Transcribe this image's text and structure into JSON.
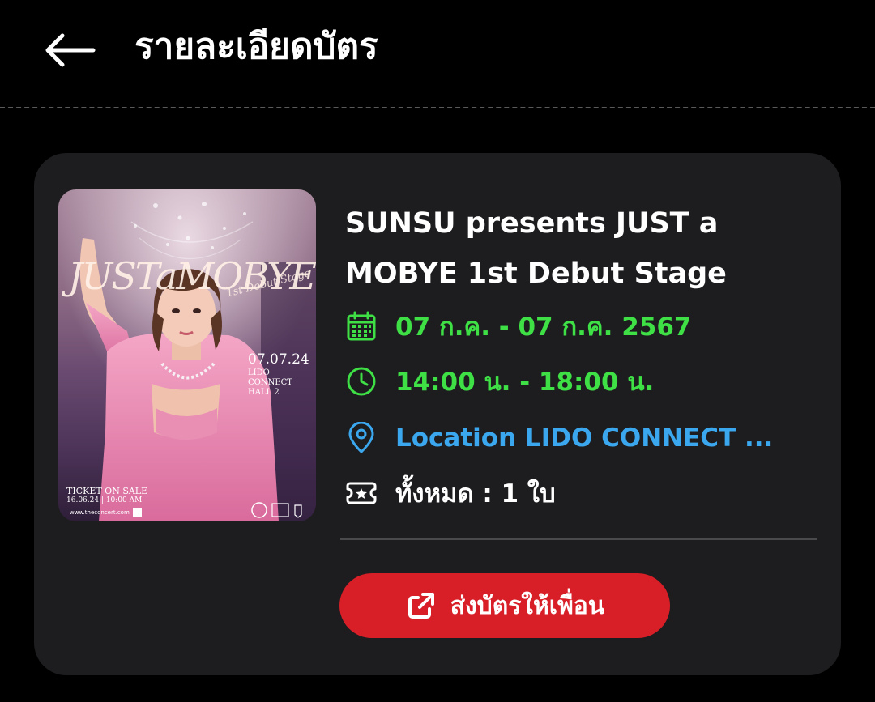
{
  "header": {
    "title": "รายละเอียดบัตร",
    "back_icon": "arrow-left-icon"
  },
  "poster": {
    "logo_text": "JUSTaMOBYE",
    "subtitle": "1st Debut Stage",
    "date": "07.07.24",
    "venue": "LIDO CONNECT HALL 2",
    "sale_label": "TICKET ON SALE",
    "sale_date": "16.06.24 | 10:00 AM",
    "url": "www.theconcert.com"
  },
  "event": {
    "title": "SUNSU presents JUST a MOBYE 1st Debut Stage",
    "date_range": "07 ก.ค. - 07 ก.ค. 2567",
    "time_range": "14:00 น. - 18:00 น.",
    "location": "Location LIDO CONNECT ...",
    "ticket_count": "ทั้งหมด : 1 ใบ"
  },
  "actions": {
    "share_label": "ส่งบัตรให้เพื่อน",
    "share_icon": "external-link-icon"
  },
  "colors": {
    "background": "#000000",
    "card": "#1d1d1f",
    "accent_green": "#3ee046",
    "accent_blue": "#3aa7ee",
    "button_red": "#d81e27"
  }
}
